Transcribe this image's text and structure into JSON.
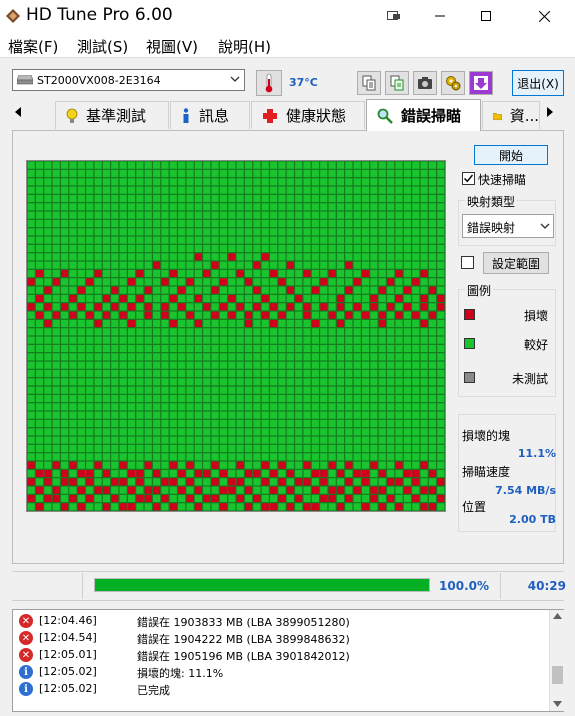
{
  "window": {
    "title": "HD Tune Pro 6.00",
    "icon": "hdtune-diamond-icon"
  },
  "menu": [
    "檔案(F)",
    "測試(S)",
    "視圖(V)",
    "說明(H)"
  ],
  "toolbar": {
    "drive": "ST2000VX008-2E3164",
    "temperature": "37°C",
    "exit_label": "退出(X)",
    "buttons": [
      "copy-text-icon",
      "copy-info-icon",
      "screenshot-icon",
      "options-icon",
      "save-icon"
    ]
  },
  "tabs": [
    {
      "label": "基準測試",
      "icon": "lightbulb-icon",
      "active": false
    },
    {
      "label": "訊息",
      "icon": "info-icon",
      "active": false
    },
    {
      "label": "健康狀態",
      "icon": "health-cross-icon",
      "active": false
    },
    {
      "label": "錯誤掃瞄",
      "icon": "magnifier-icon",
      "active": true
    },
    {
      "label": "資...",
      "icon": "folder-icon",
      "active": false
    }
  ],
  "scan": {
    "start_label": "開始",
    "quick_scan_label": "快速掃瞄",
    "quick_scan_checked": true,
    "map_type_title": "映射類型",
    "map_type_value": "錯誤映射",
    "range_label": "設定範圍",
    "range_checked": false
  },
  "legend": {
    "title": "圖例",
    "items": [
      {
        "label": "損壞",
        "color": "#d0021b"
      },
      {
        "label": "較好",
        "color": "#19c42e"
      },
      {
        "label": "未測試",
        "color": "#8a8a8a"
      }
    ]
  },
  "stats": {
    "damaged_label": "損壞的塊",
    "damaged_value": "11.1%",
    "speed_label": "掃瞄速度",
    "speed_value": "7.54 MB/s",
    "position_label": "位置",
    "position_value": "2.00 TB"
  },
  "progress": {
    "value": 1.0,
    "text": "100.0%",
    "time": "40:29"
  },
  "log": [
    {
      "type": "error",
      "time": "[12:04.46]",
      "msg": "錯誤在 1903833 MB (LBA 3899051280)"
    },
    {
      "type": "error",
      "time": "[12:04.54]",
      "msg": "錯誤在 1904222 MB (LBA 3899848632)"
    },
    {
      "type": "error",
      "time": "[12:05.01]",
      "msg": "錯誤在 1905196 MB (LBA 3901842012)"
    },
    {
      "type": "info",
      "time": "[12:05.02]",
      "msg": "損壞的塊: 11.1%"
    },
    {
      "type": "info",
      "time": "[12:05.02]",
      "msg": "已完成"
    }
  ],
  "error_map": {
    "cols": 50,
    "rows": 42,
    "good_color": "#19c42e",
    "bad_color": "#d0021b",
    "grid_color": "#157a20",
    "damaged_rows": [
      [
        11,
        [
          20,
          24,
          28
        ]
      ],
      [
        12,
        [
          15,
          22,
          27,
          31,
          38
        ]
      ],
      [
        13,
        [
          1,
          4,
          8,
          13,
          17,
          21,
          25,
          29,
          33,
          36,
          40,
          44,
          47
        ]
      ],
      [
        14,
        [
          0,
          3,
          7,
          12,
          16,
          19,
          23,
          26,
          30,
          35,
          39,
          43,
          46
        ]
      ],
      [
        15,
        [
          2,
          6,
          10,
          14,
          18,
          22,
          27,
          31,
          34,
          38,
          42,
          45,
          48
        ]
      ],
      [
        16,
        [
          1,
          5,
          9,
          11,
          13,
          17,
          20,
          24,
          28,
          32,
          37,
          41,
          44,
          47,
          49
        ]
      ],
      [
        17,
        [
          0,
          2,
          4,
          6,
          8,
          10,
          12,
          14,
          16,
          18,
          21,
          23,
          25,
          27,
          29,
          31,
          33,
          35,
          37,
          39,
          41,
          43,
          45,
          47,
          49
        ]
      ],
      [
        18,
        [
          1,
          3,
          5,
          7,
          9,
          11,
          14,
          16,
          19,
          22,
          24,
          26,
          28,
          30,
          33,
          36,
          38,
          40,
          42,
          44,
          46,
          48
        ]
      ],
      [
        19,
        [
          2,
          8,
          12,
          17,
          20,
          26,
          29,
          34,
          37,
          42,
          47
        ]
      ],
      [
        36,
        [
          0,
          3,
          5,
          8,
          11,
          14,
          17,
          19,
          22,
          25,
          28,
          30,
          33,
          36,
          38,
          41,
          44,
          47
        ]
      ],
      [
        37,
        [
          1,
          2,
          4,
          6,
          7,
          9,
          12,
          13,
          15,
          18,
          20,
          21,
          23,
          26,
          27,
          29,
          31,
          34,
          35,
          37,
          39,
          40,
          42,
          45,
          46,
          48
        ]
      ],
      [
        38,
        [
          0,
          2,
          4,
          5,
          7,
          10,
          11,
          13,
          16,
          17,
          19,
          22,
          24,
          25,
          28,
          30,
          32,
          33,
          35,
          38,
          40,
          43,
          44,
          46,
          49
        ]
      ],
      [
        39,
        [
          1,
          3,
          6,
          8,
          9,
          12,
          14,
          15,
          18,
          20,
          23,
          24,
          26,
          29,
          31,
          34,
          36,
          37,
          39,
          41,
          42,
          45,
          47,
          48
        ]
      ],
      [
        40,
        [
          0,
          2,
          3,
          5,
          7,
          10,
          13,
          14,
          16,
          19,
          21,
          22,
          25,
          27,
          30,
          32,
          35,
          36,
          38,
          41,
          43,
          46,
          49
        ]
      ],
      [
        41,
        [
          1,
          4,
          6,
          9,
          11,
          12,
          15,
          17,
          20,
          23,
          26,
          28,
          29,
          31,
          33,
          34,
          37,
          40,
          42,
          44,
          47,
          48
        ]
      ]
    ]
  }
}
